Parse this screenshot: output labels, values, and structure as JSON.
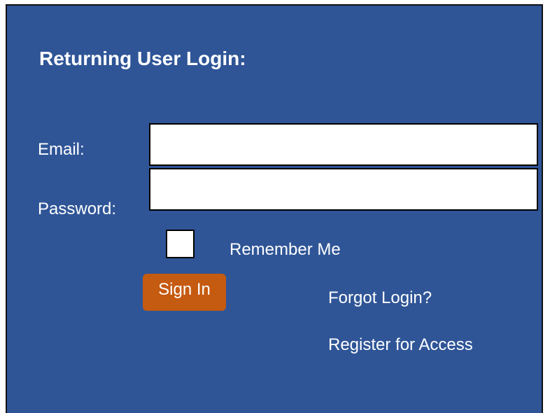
{
  "login": {
    "title": "Returning User Login:",
    "email_label": "Email:",
    "email_value": "",
    "password_label": "Password:",
    "password_value": "",
    "remember_label": "Remember Me",
    "remember_checked": false,
    "signin_label": "Sign In",
    "forgot_link": "Forgot Login?",
    "register_link": "Register for Access"
  },
  "colors": {
    "panel_background": "#2f5597",
    "signin_button": "#c55a11",
    "text": "#ffffff"
  }
}
